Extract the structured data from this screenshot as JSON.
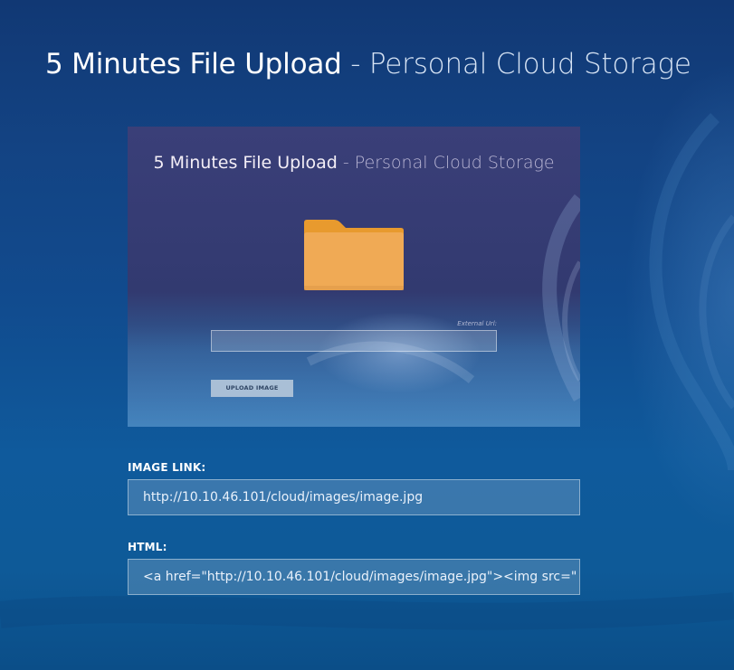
{
  "header": {
    "title_main": "5 Minutes File Upload",
    "title_sub": "- Personal Cloud Storage"
  },
  "preview": {
    "title_main": "5 Minutes File Upload",
    "title_sub": "- Personal Cloud Storage",
    "icon": "folder-icon",
    "external_url_label": "External Url:",
    "external_url_value": "",
    "upload_button_label": "UPLOAD IMAGE"
  },
  "fields": {
    "image_link_label": "IMAGE LINK:",
    "image_link_value": "http://10.10.46.101/cloud/images/image.jpg",
    "html_label": "HTML:",
    "html_value": "<a href=\"http://10.10.46.101/cloud/images/image.jpg\"><img src=\""
  },
  "colors": {
    "background_top": "#113874",
    "background_bottom": "#0e5a98",
    "folder": "#f0aa55",
    "folder_tab": "#e89a2e",
    "button": "#a9bfd6"
  }
}
